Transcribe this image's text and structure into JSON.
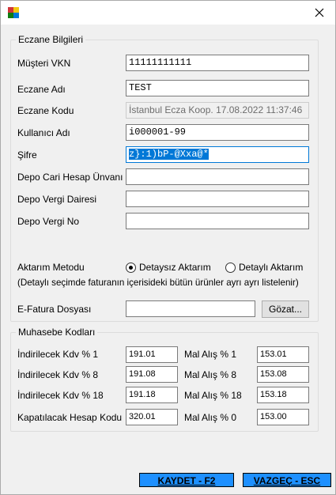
{
  "window": {
    "title": ""
  },
  "eczane": {
    "group_title": "Eczane Bilgileri",
    "musteri_vkn_label": "Müşteri VKN",
    "musteri_vkn_value": "11111111111",
    "eczane_adi_label": "Eczane Adı",
    "eczane_adi_value": "TEST",
    "eczane_kodu_label": "Eczane Kodu",
    "eczane_kodu_value": "İstanbul Ecza Koop. 17.08.2022 11:37:46",
    "kullanici_adi_label": "Kullanıcı Adı",
    "kullanici_adi_value": "i000001-99",
    "sifre_label": "Şifre",
    "sifre_value": "z}:1)bP-@Xxa@*",
    "depo_cari_label": "Depo Cari Hesap Ünvanı",
    "depo_cari_value": "",
    "depo_vergi_dairesi_label": "Depo Vergi Dairesi",
    "depo_vergi_dairesi_value": "",
    "depo_vergi_no_label": "Depo Vergi No",
    "depo_vergi_no_value": "",
    "aktarim_metodu_label": "Aktarım Metodu",
    "radio_detaysiz": "Detaysız Aktarım",
    "radio_detayli": "Detaylı Aktarım",
    "aktarim_note": "(Detaylı seçimde faturanın içerisideki bütün ürünler ayrı ayrı listelenir)",
    "efatura_label": "E-Fatura Dosyası",
    "efatura_value": "",
    "gozat_button": "Gözat..."
  },
  "muhasebe": {
    "group_title": "Muhasebe Kodları",
    "rows": [
      {
        "left_label": "İndirilecek Kdv  % 1",
        "left_value": "191.01",
        "right_label": "Mal Alış  % 1",
        "right_value": "153.01"
      },
      {
        "left_label": "İndirilecek Kdv  % 8",
        "left_value": "191.08",
        "right_label": "Mal Alış  % 8",
        "right_value": "153.08"
      },
      {
        "left_label": "İndirilecek Kdv  % 18",
        "left_value": "191.18",
        "right_label": "Mal Alış  % 18",
        "right_value": "153.18"
      },
      {
        "left_label": "Kapatılacak Hesap Kodu",
        "left_value": "320.01",
        "right_label": "Mal Alış  % 0",
        "right_value": "153.00"
      }
    ]
  },
  "footer": {
    "kaydet_button": "KAYDET - F2",
    "vazgec_button": "VAZGEÇ - ESC"
  },
  "colors": {
    "accent": "#1e90ff",
    "selection": "#0078d7"
  }
}
